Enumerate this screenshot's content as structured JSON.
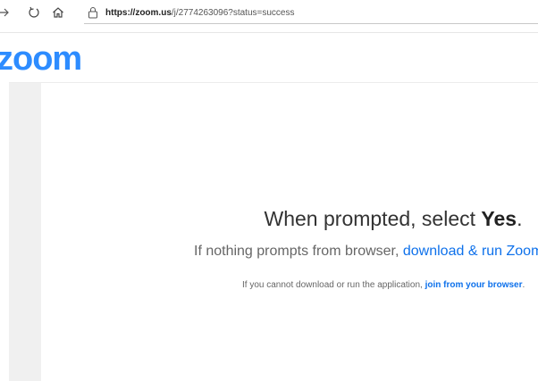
{
  "browser": {
    "url_host": "https://zoom.us",
    "url_path": "/j/2774263096?status=success"
  },
  "header": {
    "logo_text": "zoom"
  },
  "main": {
    "title_prefix": "When prompted, select ",
    "title_emphasis": "Yes",
    "title_suffix": ".",
    "subtitle_prefix": "If nothing prompts from browser, ",
    "subtitle_link": "download & run Zoom",
    "subtitle_suffix": ".",
    "small_prefix": "If you cannot download or run the application, ",
    "small_link": "join from your browser",
    "small_suffix": "."
  },
  "colors": {
    "zoom_blue": "#2d8cff",
    "link_blue": "#0e71eb",
    "sidebar_gray": "#f0f0f0"
  }
}
